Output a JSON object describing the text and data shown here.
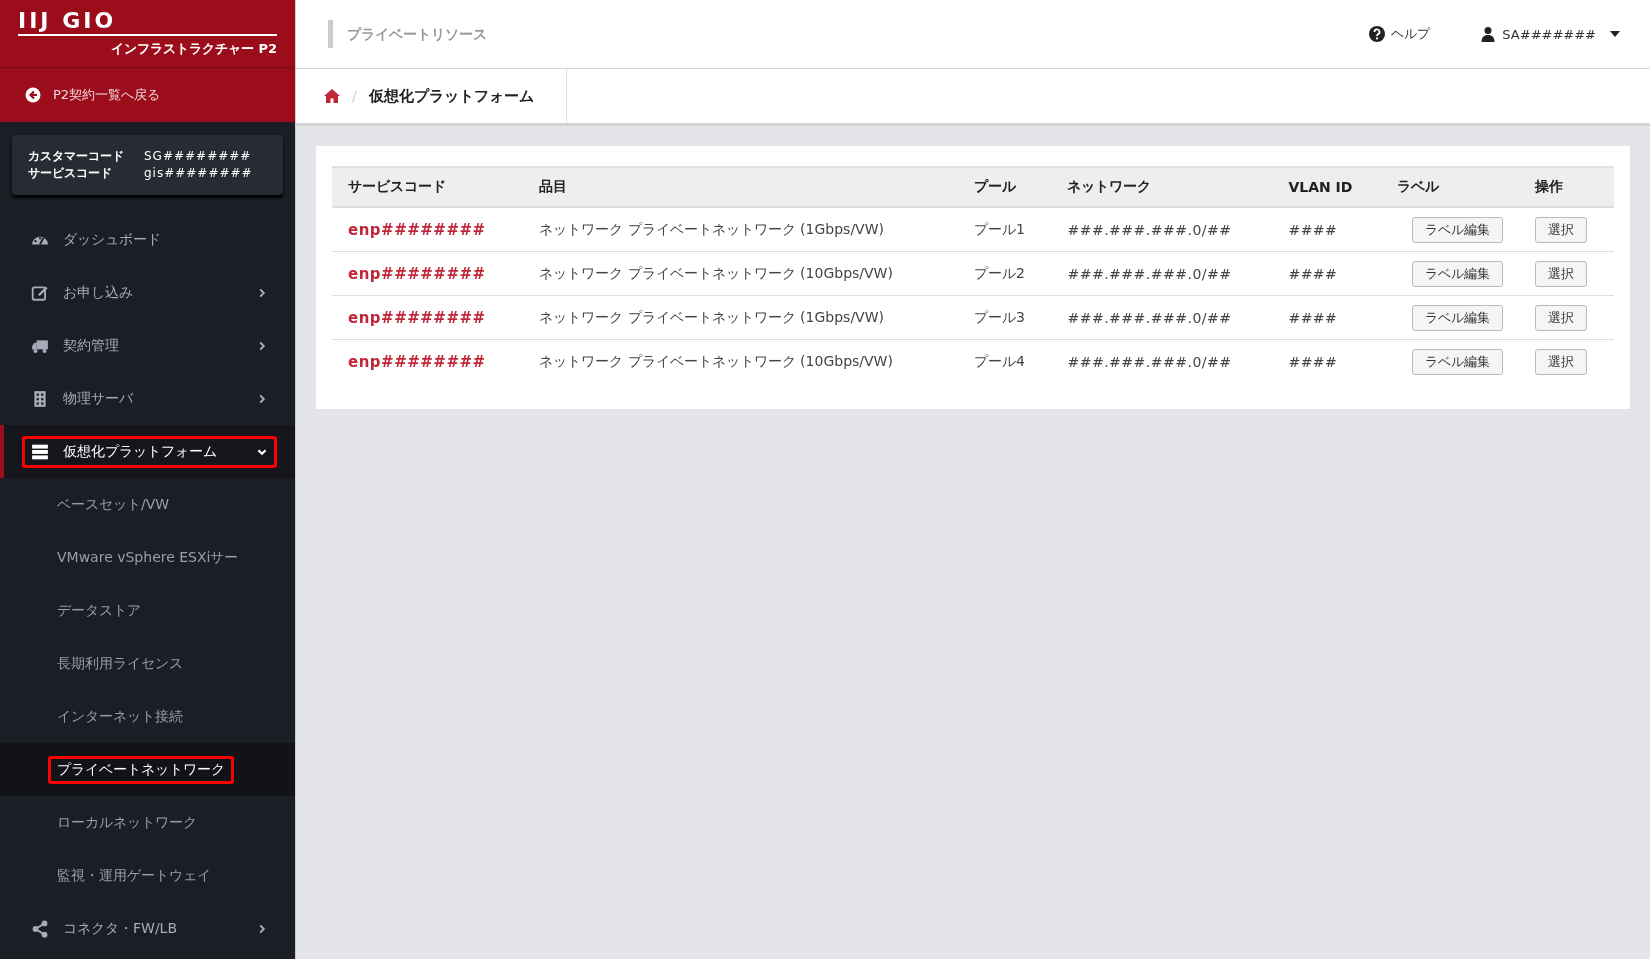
{
  "brand": {
    "logo": "IIJ GIO",
    "subtitle": "インフラストラクチャー P2"
  },
  "back_link": "P2契約一覧へ戻る",
  "account": [
    {
      "label": "カスタマーコード",
      "value": "SG########"
    },
    {
      "label": "サービスコード",
      "value": "gis########"
    }
  ],
  "sidebar": {
    "items": [
      {
        "label": "ダッシュボード",
        "has_submenu": false,
        "expanded": false,
        "selected": false,
        "highlighted": false
      },
      {
        "label": "お申し込み",
        "has_submenu": true,
        "expanded": false,
        "selected": false,
        "highlighted": false
      },
      {
        "label": "契約管理",
        "has_submenu": true,
        "expanded": false,
        "selected": false,
        "highlighted": false
      },
      {
        "label": "物理サーバ",
        "has_submenu": true,
        "expanded": false,
        "selected": false,
        "highlighted": false
      },
      {
        "label": "仮想化プラットフォーム",
        "has_submenu": true,
        "expanded": true,
        "selected": true,
        "highlighted": true,
        "children": [
          {
            "label": "ベースセット/VW",
            "selected": false,
            "highlighted": false
          },
          {
            "label": "VMware vSphere ESXiサー",
            "selected": false,
            "highlighted": false
          },
          {
            "label": "データストア",
            "selected": false,
            "highlighted": false
          },
          {
            "label": "長期利用ライセンス",
            "selected": false,
            "highlighted": false
          },
          {
            "label": "インターネット接続",
            "selected": false,
            "highlighted": false
          },
          {
            "label": "プライベートネットワーク",
            "selected": true,
            "highlighted": true
          },
          {
            "label": "ローカルネットワーク",
            "selected": false,
            "highlighted": false
          },
          {
            "label": "監視・運用ゲートウェイ",
            "selected": false,
            "highlighted": false
          }
        ]
      },
      {
        "label": "コネクタ・FW/LB",
        "has_submenu": true,
        "expanded": false,
        "selected": false,
        "highlighted": false
      }
    ]
  },
  "header": {
    "section": "プライベートリソース",
    "help": "ヘルプ",
    "user": "SA#######"
  },
  "breadcrumb": {
    "separator": "/",
    "items": [
      "仮想化プラットフォーム"
    ]
  },
  "table": {
    "columns": [
      "サービスコード",
      "品目",
      "プール",
      "ネットワーク",
      "VLAN ID",
      "ラベル",
      "操作"
    ],
    "rows": [
      {
        "service_code": "enp########",
        "item": "ネットワーク プライベートネットワーク (1Gbps/VW)",
        "pool": "プール1",
        "network": "###.###.###.0/##",
        "vlan_id": "####",
        "label_button": "ラベル編集",
        "action_button": "選択"
      },
      {
        "service_code": "enp########",
        "item": "ネットワーク プライベートネットワーク (10Gbps/VW)",
        "pool": "プール2",
        "network": "###.###.###.0/##",
        "vlan_id": "####",
        "label_button": "ラベル編集",
        "action_button": "選択"
      },
      {
        "service_code": "enp########",
        "item": "ネットワーク プライベートネットワーク (1Gbps/VW)",
        "pool": "プール3",
        "network": "###.###.###.0/##",
        "vlan_id": "####",
        "label_button": "ラベル編集",
        "action_button": "選択"
      },
      {
        "service_code": "enp########",
        "item": "ネットワーク プライベートネットワーク (10Gbps/VW)",
        "pool": "プール4",
        "network": "###.###.###.0/##",
        "vlan_id": "####",
        "label_button": "ラベル編集",
        "action_button": "選択"
      }
    ]
  }
}
